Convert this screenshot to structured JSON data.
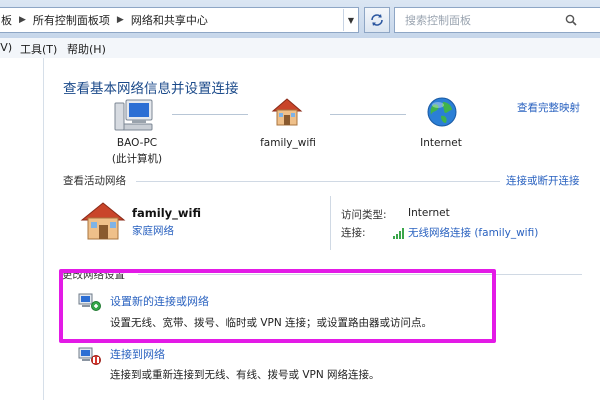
{
  "address_bar": {
    "breadcrumbs": [
      "板",
      "所有控制面板项",
      "网络和共享中心"
    ],
    "search_placeholder": "搜索控制面板"
  },
  "menu": {
    "items": [
      "(V)",
      "工具(T)",
      "帮助(H)"
    ]
  },
  "main": {
    "title": "查看基本网络信息并设置连接",
    "full_map_link": "查看完整映射",
    "map_nodes": [
      {
        "label": "BAO-PC",
        "sublabel": "(此计算机)",
        "icon": "computer-icon"
      },
      {
        "label": "family_wifi",
        "icon": "house-icon"
      },
      {
        "label": "Internet",
        "icon": "globe-icon"
      }
    ],
    "active_networks": {
      "header": "查看活动网络",
      "connect_link": "连接或断开连接",
      "network_name": "family_wifi",
      "network_type": "家庭网络",
      "access_type_label": "访问类型:",
      "access_type_value": "Internet",
      "connection_label": "连接:",
      "connection_value": "无线网络连接 (family_wifi)"
    },
    "change_settings": {
      "header": "更改网络设置",
      "tasks": [
        {
          "title": "设置新的连接或网络",
          "description": "设置无线、宽带、拨号、临时或 VPN 连接；或设置路由器或访问点。"
        },
        {
          "title": "连接到网络",
          "description": "连接到或重新连接到无线、有线、拨号或 VPN 网络连接。"
        }
      ]
    }
  },
  "colors": {
    "link": "#2a62c0",
    "title": "#1b4a8a",
    "highlight": "#e31ae6"
  }
}
